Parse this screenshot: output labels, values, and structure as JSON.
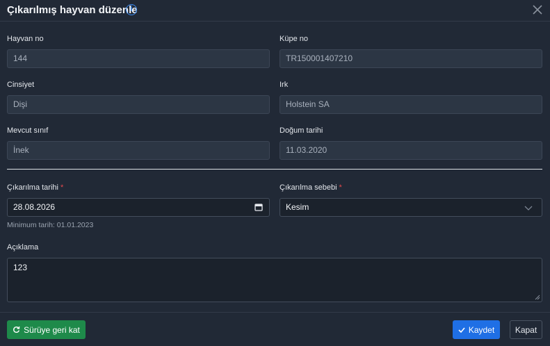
{
  "dialog": {
    "title": "Çıkarılmış hayvan düzenle",
    "info_icon": "info-icon",
    "close_icon": "close-icon"
  },
  "fields": {
    "animal_no": {
      "label": "Hayvan no",
      "value": "144"
    },
    "ear_tag": {
      "label": "Küpe no",
      "value": "TR150001407210"
    },
    "gender": {
      "label": "Cinsiyet",
      "value": "Dişi"
    },
    "breed": {
      "label": "Irk",
      "value": "Holstein SA"
    },
    "current_class": {
      "label": "Mevcut sınıf",
      "value": "İnek"
    },
    "birth_date": {
      "label": "Doğum tarihi",
      "value": "11.03.2020"
    },
    "removal_date": {
      "label": "Çıkarılma tarihi",
      "required_mark": "*",
      "value": "28.08.2026",
      "hint": "Minimum tarih: 01.01.2023",
      "icon": "calendar-icon"
    },
    "removal_reason": {
      "label": "Çıkarılma sebebi",
      "required_mark": "*",
      "value": "Kesim",
      "icon": "chevron-down-icon"
    },
    "description": {
      "label": "Açıklama",
      "value": "123"
    }
  },
  "footer": {
    "return_button": {
      "label": "Sürüye geri kat",
      "icon": "rotate-icon"
    },
    "save_button": {
      "label": "Kaydet",
      "icon": "check-icon"
    },
    "close_button": {
      "label": "Kapat"
    }
  },
  "colors": {
    "background": "#212936",
    "readonly_field": "#2c3644",
    "active_field": "#1b222c",
    "primary": "#1f6fe5",
    "success": "#1e8a4a",
    "required": "#e5484d",
    "info": "#3b8cf5"
  }
}
